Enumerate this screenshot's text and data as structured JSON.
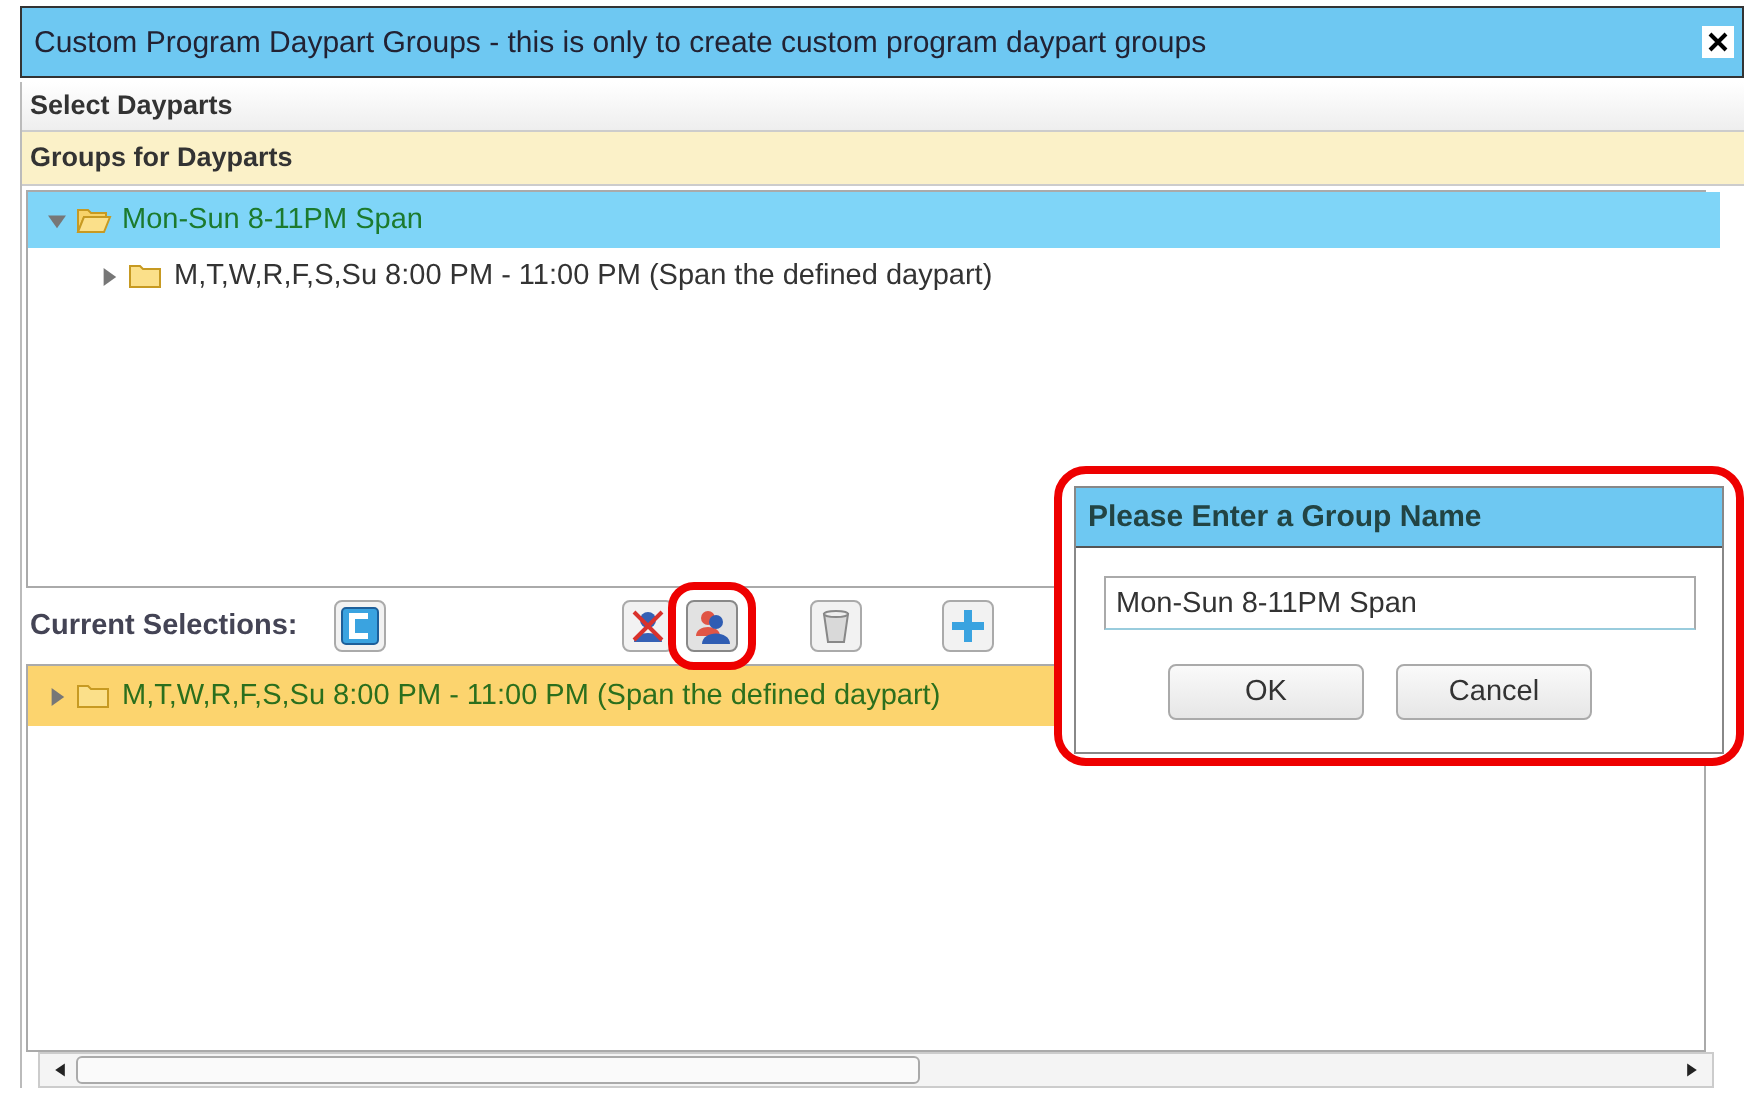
{
  "window": {
    "title": "Custom Program Daypart Groups - this is only to create custom program daypart groups"
  },
  "sections": [
    {
      "label": "Select Dayparts",
      "kind": "plain"
    },
    {
      "label": "Groups for Dayparts",
      "kind": "highlight"
    }
  ],
  "tree": [
    {
      "label": "Mon-Sun 8-11PM Span",
      "expanded": true,
      "selected": true,
      "children": [
        {
          "label": "M,T,W,R,F,S,Su 8:00 PM - 11:00 PM (Span the defined daypart)",
          "expanded": false,
          "selected": false
        }
      ]
    }
  ],
  "current_selections": {
    "label": "Current Selections:",
    "tools": [
      {
        "kind": "clear",
        "highlighted": false
      },
      {
        "kind": "remove-user",
        "highlighted": false
      },
      {
        "kind": "users",
        "highlighted": true
      },
      {
        "kind": "trash",
        "highlighted": false
      },
      {
        "kind": "add",
        "highlighted": false
      }
    ],
    "items": [
      {
        "label": "M,T,W,R,F,S,Su 8:00 PM - 11:00 PM (Span the defined daypart)",
        "selected": true
      }
    ]
  },
  "dialog": {
    "title": "Please Enter a Group Name",
    "value": "Mon-Sun 8-11PM Span",
    "buttons": [
      "OK",
      "Cancel"
    ],
    "highlighted": true
  }
}
